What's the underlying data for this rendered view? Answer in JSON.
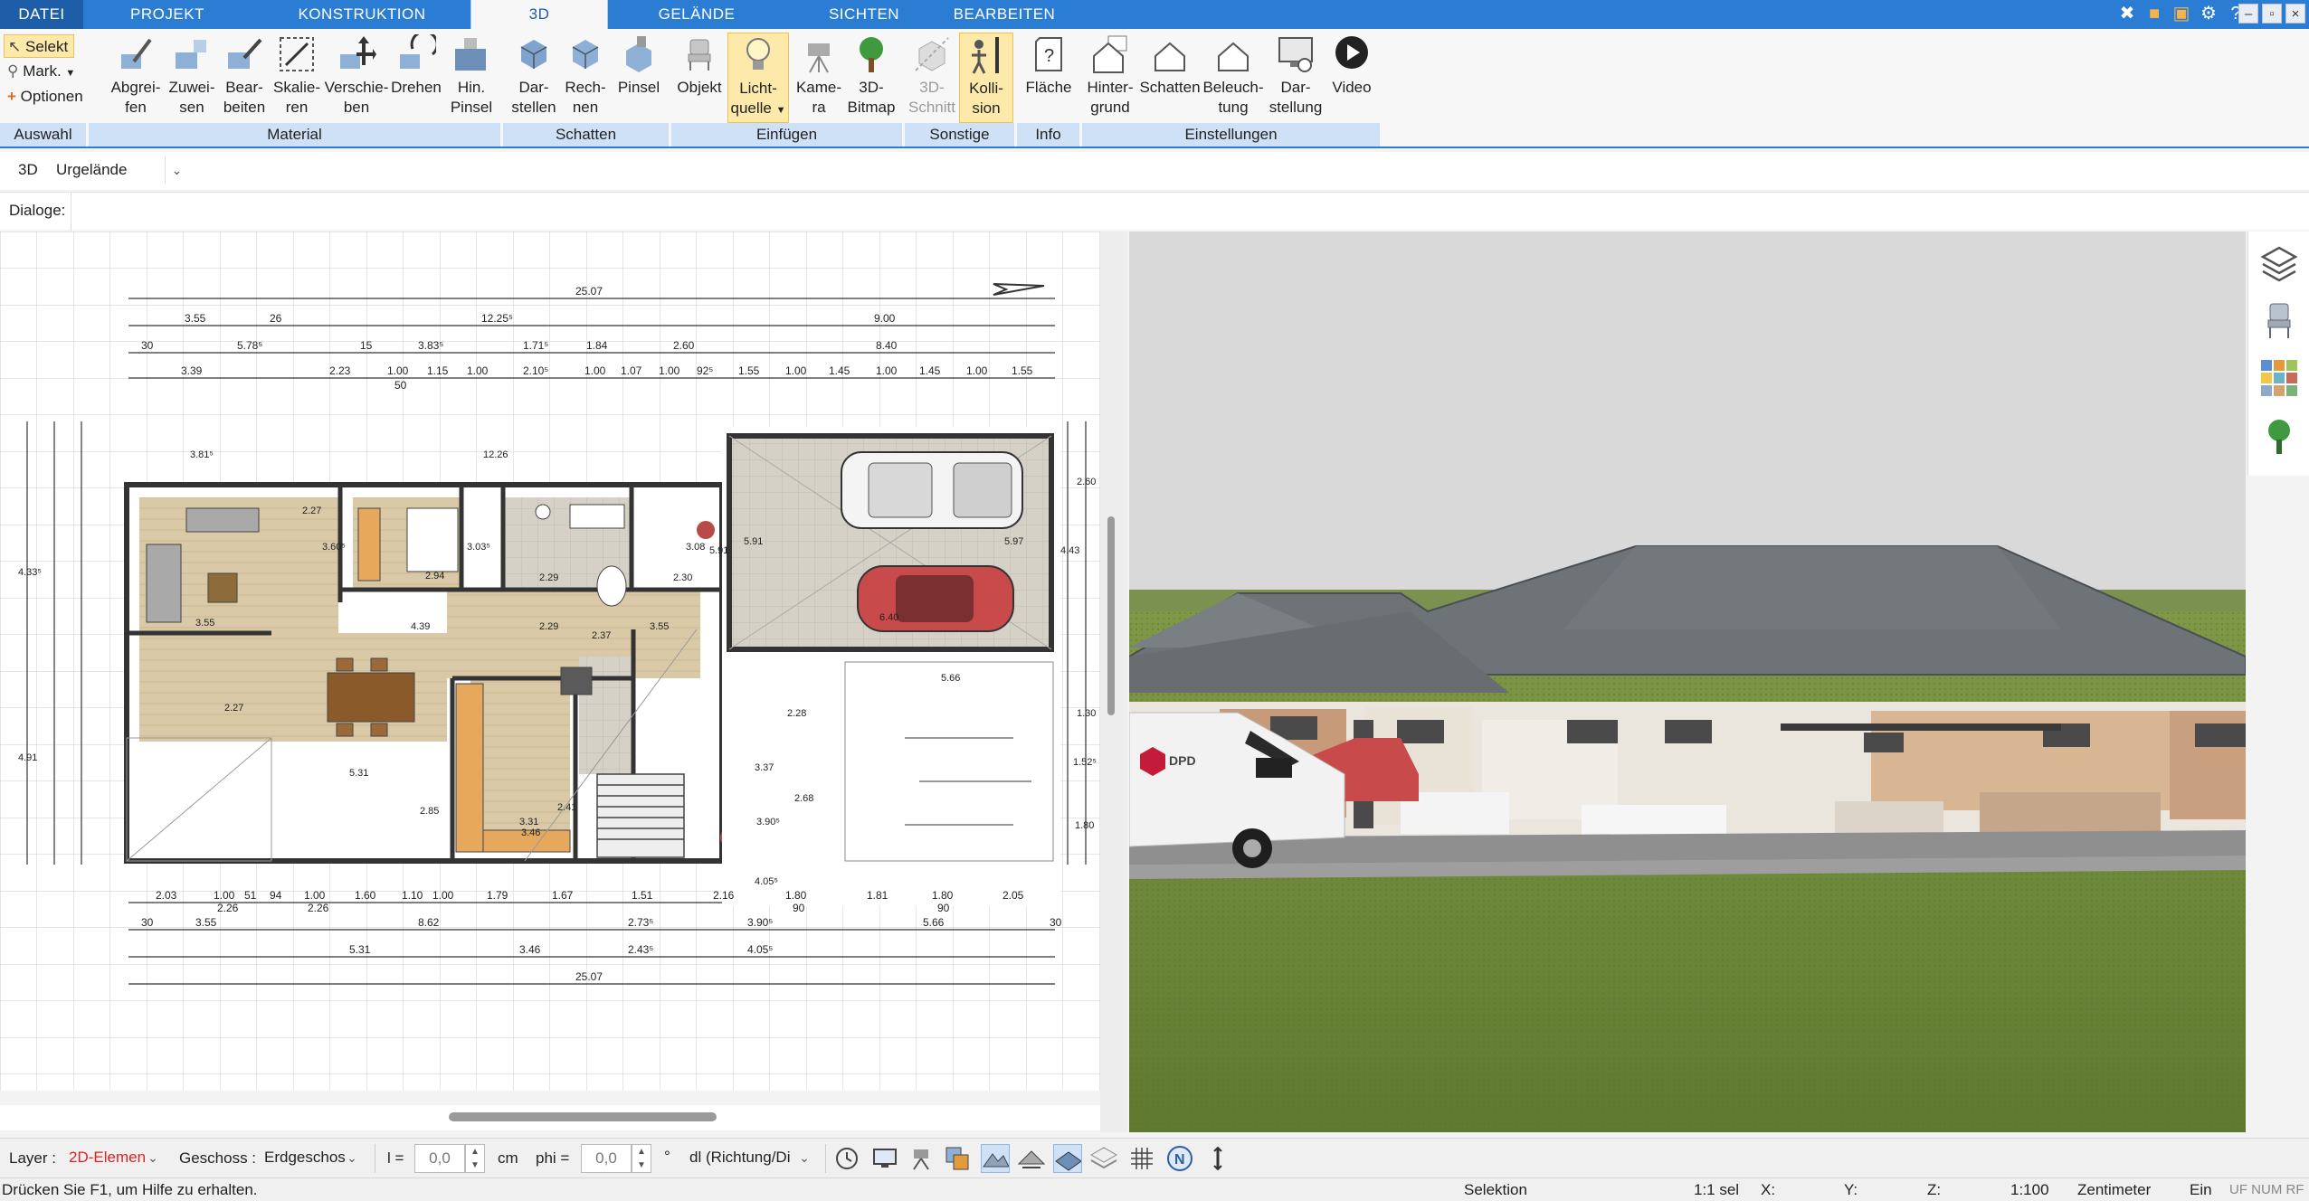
{
  "tabs": [
    "DATEI",
    "PROJEKT",
    "KONSTRUKTION",
    "3D",
    "GELÄNDE",
    "SICHTEN",
    "BEARBEITEN"
  ],
  "active_tab": "3D",
  "window_controls": [
    "tools-icon",
    "cube-icon",
    "screen-icon",
    "help-icon",
    "minimize",
    "restore",
    "close"
  ],
  "selection": {
    "selekt": "Selekt",
    "mark": "Mark.",
    "optionen": "Optionen"
  },
  "ribbon": {
    "groups": [
      "Auswahl",
      "Material",
      "Schatten",
      "Einfügen",
      "Sonstige",
      "Info",
      "Einstellungen"
    ],
    "buttons": [
      {
        "l1": "Abgrei-",
        "l2": "fen"
      },
      {
        "l1": "Zuwei-",
        "l2": "sen"
      },
      {
        "l1": "Bear-",
        "l2": "beiten"
      },
      {
        "l1": "Skalie-",
        "l2": "ren"
      },
      {
        "l1": "Verschie-",
        "l2": "ben"
      },
      {
        "l1": "Drehen",
        "l2": ""
      },
      {
        "l1": "Hin.",
        "l2": "Pinsel"
      },
      {
        "l1": "Dar-",
        "l2": "stellen"
      },
      {
        "l1": "Rech-",
        "l2": "nen"
      },
      {
        "l1": "Pinsel",
        "l2": ""
      },
      {
        "l1": "Objekt",
        "l2": ""
      },
      {
        "l1": "Licht-",
        "l2": "quelle"
      },
      {
        "l1": "Kame-",
        "l2": "ra"
      },
      {
        "l1": "3D-",
        "l2": "Bitmap"
      },
      {
        "l1": "3D-",
        "l2": "Schnitt"
      },
      {
        "l1": "Kolli-",
        "l2": "sion"
      },
      {
        "l1": "Fläche",
        "l2": ""
      },
      {
        "l1": "Hinter-",
        "l2": "grund"
      },
      {
        "l1": "Schatten",
        "l2": ""
      },
      {
        "l1": "Beleuch-",
        "l2": "tung"
      },
      {
        "l1": "Dar-",
        "l2": "stellung"
      },
      {
        "l1": "Video",
        "l2": ""
      }
    ]
  },
  "view_toolbar": {
    "mode": "3D",
    "terrain": "Urgelände"
  },
  "dialog_toolbar": {
    "label": "Dialoge:"
  },
  "plan": {
    "dims_top": [
      "25.07",
      "3.55",
      "26",
      "12.25⁵",
      "9.00",
      "30",
      "5.78⁵",
      "1.71⁵",
      "1.84",
      "2.60",
      "8.40",
      "3.83⁵",
      "15",
      "3.39",
      "2.23",
      "1.00",
      "1.15",
      "1.00",
      "2.10⁵",
      "1.00",
      "1.07",
      "1.00",
      "92⁵",
      "1.55",
      "1.00",
      "1.45",
      "1.00",
      "1.45",
      "1.00",
      "1.55",
      "50"
    ],
    "dims_bottom": [
      "2.03",
      "1.00",
      "51",
      "94",
      "1.00",
      "1.60",
      "1.10",
      "1.00",
      "1.79",
      "1.67",
      "1.51",
      "2.16",
      "1.80",
      "1.81",
      "1.80",
      "2.05",
      "2.26",
      "2.26",
      "90",
      "90",
      "30",
      "3.55",
      "8.62",
      "2.73⁵",
      "3.90⁵",
      "5.66",
      "30",
      "5.31",
      "3.46",
      "2.43⁵",
      "4.05⁵",
      "25.07"
    ],
    "room_labels": [
      "3.81⁵",
      "12.26",
      "2.27",
      "3.60⁵",
      "3.03⁵",
      "2.94",
      "2.29",
      "2.30",
      "3.08",
      "3.55",
      "4.39",
      "2.29",
      "2.37",
      "3.55",
      "5.31",
      "3.31",
      "2.41",
      "2.85",
      "5.91",
      "5.97",
      "5.66",
      "6.40",
      "2.28",
      "3.37",
      "2.68",
      "3.90⁵",
      "4.05⁵",
      "3.46",
      "2.27",
      "4.33⁵",
      "4.91",
      "5.91",
      "2.60",
      "4.43",
      "1.52⁵",
      "1.80",
      "1.30"
    ]
  },
  "bottom_bar": {
    "layer_label": "Layer :",
    "layer_value": "2D-Elemen",
    "geschoss_label": "Geschoss :",
    "geschoss_value": "Erdgeschos",
    "l_label": "l =",
    "l_value": "0,0",
    "l_unit": "cm",
    "phi_label": "phi =",
    "phi_value": "0,0",
    "phi_unit": "°",
    "dl_value": "dl (Richtung/Di"
  },
  "status": {
    "help": "Drücken Sie F1, um Hilfe zu erhalten.",
    "mode": "Selektion",
    "sel": "1:1 sel",
    "x": "X:",
    "y": "Y:",
    "z": "Z:",
    "scale": "1:100",
    "unit": "Zentimeter",
    "ein": "Ein",
    "flags": "UF NUM RF"
  },
  "colors": {
    "accent": "#2b7cd3",
    "ribbon_group": "#cfe1f6",
    "highlight": "#fde9a9",
    "floor_wood": "#d9c9a6",
    "grass": "#6f8a3a",
    "roof": "#6e7378",
    "car_red": "#c94a4a"
  }
}
